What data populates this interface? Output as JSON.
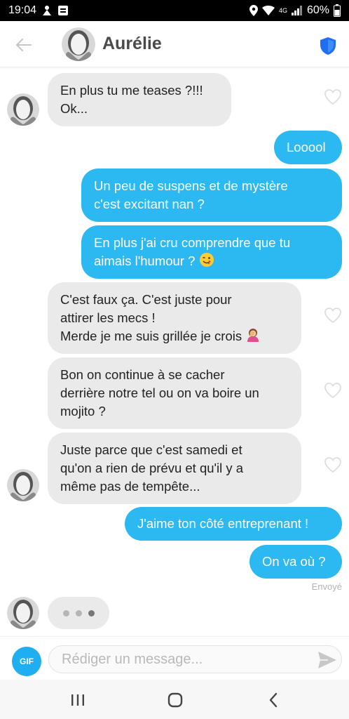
{
  "status_bar": {
    "time": "19:04",
    "network": "4G",
    "battery": "60%"
  },
  "header": {
    "contact_name": "Aurélie",
    "shield_color": "#1f6ff0"
  },
  "messages": [
    {
      "side": "in",
      "lines": [
        "En plus tu me teases ?!!!",
        "Ok..."
      ]
    },
    {
      "side": "out",
      "text": "Looool"
    },
    {
      "side": "out",
      "lines": [
        "Un peu de suspens et de mystère",
        "c'est excitant nan ?"
      ]
    },
    {
      "side": "out",
      "lines": [
        "En plus j'ai cru comprendre que tu",
        "aimais l'humour ? "
      ],
      "emoji": "winking-face"
    },
    {
      "side": "in",
      "lines": [
        "C'est faux ça. C'est juste pour",
        "attirer les mecs !",
        "Merde je me suis grillée je crois "
      ],
      "emoji": "woman-facepalming"
    },
    {
      "side": "in",
      "lines": [
        "Bon on continue à se cacher",
        "derrière notre tel ou on va boire un",
        "mojito ?"
      ]
    },
    {
      "side": "in",
      "lines": [
        "Juste parce que c'est samedi et",
        "qu'on a rien de prévu et qu'il y a",
        "même pas de tempête..."
      ]
    },
    {
      "side": "out",
      "text": "J'aime ton côté entreprenant !"
    },
    {
      "side": "out",
      "text": "On va où ?"
    }
  ],
  "sent_status": "Envoyé",
  "input": {
    "gif_label": "GIF",
    "placeholder": "Rédiger un message..."
  },
  "colors": {
    "outgoing_bubble": "#2cb9f2",
    "incoming_bubble": "#eaeaea",
    "gif_button": "#1faef0"
  }
}
